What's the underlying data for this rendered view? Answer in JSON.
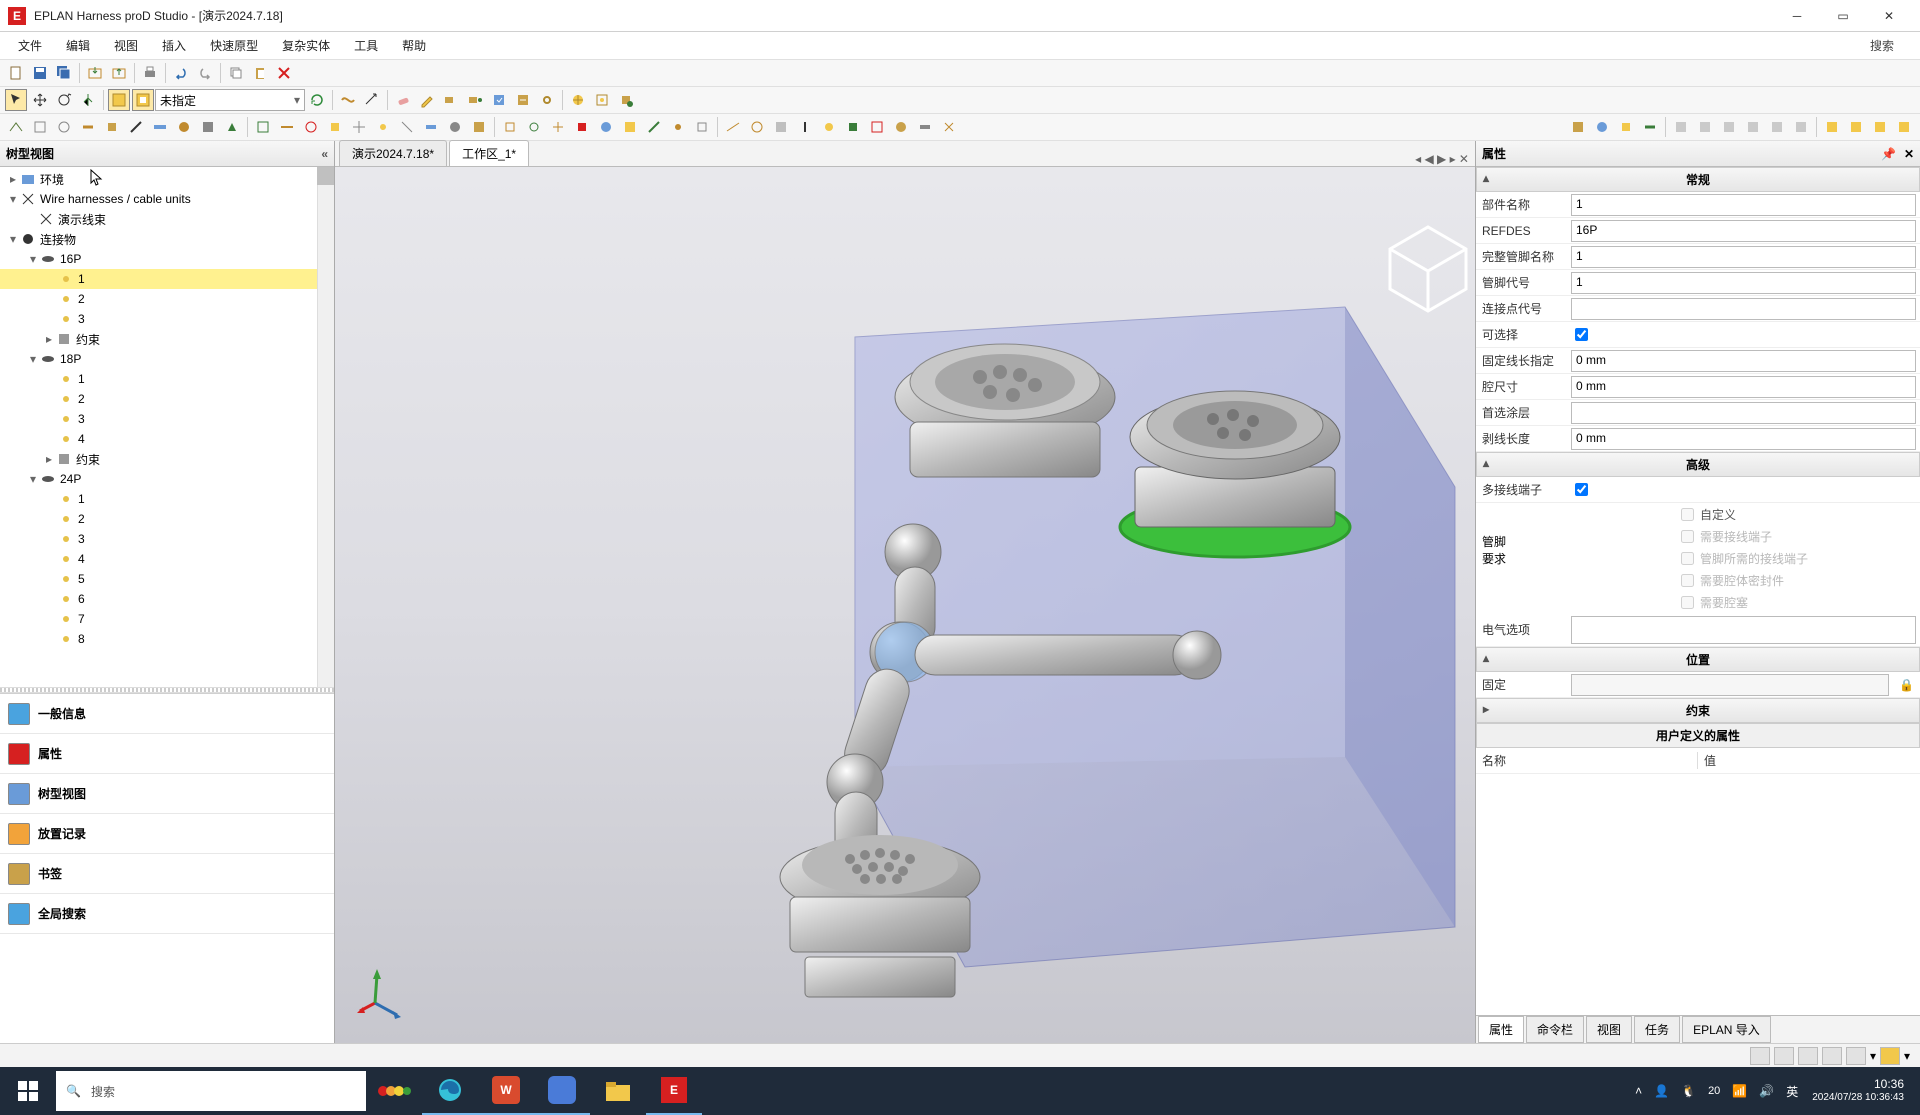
{
  "title": "EPLAN Harness proD Studio - [演示2024.7.18]",
  "menu": {
    "file": "文件",
    "edit": "编辑",
    "view": "视图",
    "insert": "插入",
    "rapid": "快速原型",
    "complex": "复杂实体",
    "tools": "工具",
    "help": "帮助",
    "search": "搜索"
  },
  "toolbar2_dropdown": "未指定",
  "left": {
    "header": "树型视图",
    "nodes": {
      "env": "环境",
      "wh": "Wire harnesses / cable units",
      "demo": "演示线束",
      "conn": "连接物",
      "p16": "16P",
      "p18": "18P",
      "p24": "24P",
      "n1": "1",
      "n2": "2",
      "n3": "3",
      "n4": "4",
      "n5": "5",
      "n6": "6",
      "n7": "7",
      "n8": "8",
      "cons": "约束"
    },
    "panels": {
      "info": "一般信息",
      "props": "属性",
      "tree": "树型视图",
      "place": "放置记录",
      "bm": "书签",
      "gs": "全局搜索"
    }
  },
  "tabs": {
    "doc1": "演示2024.7.18*",
    "doc2": "工作区_1*"
  },
  "right": {
    "header": "属性",
    "sec": {
      "gen": "常规",
      "adv": "高级",
      "pos": "位置",
      "cons": "约束",
      "user": "用户定义的属性"
    },
    "k": {
      "partname": "部件名称",
      "refdes": "REFDES",
      "fullpin": "完整管脚名称",
      "pincode": "管脚代号",
      "connpt": "连接点代号",
      "selectable": "可选择",
      "fixlen": "固定线长指定",
      "cavity": "腔尺寸",
      "coating": "首选涂层",
      "striplen": "剥线长度",
      "multiterm": "多接线端子",
      "pinreq": "管脚\n要求",
      "custom": "自定义",
      "needterm": "需要接线端子",
      "needpinterm": "管脚所需的接线端子",
      "needseal": "需要腔体密封件",
      "needplug": "需要腔塞",
      "elecopt": "电气选项",
      "fixed": "固定",
      "name": "名称",
      "value": "值"
    },
    "v": {
      "partname": "1",
      "refdes": "16P",
      "fullpin": "1",
      "pincode": "1",
      "fixlen": "0 mm",
      "cavity": "0 mm",
      "striplen": "0 mm"
    },
    "btabs": {
      "props": "属性",
      "cmd": "命令栏",
      "view": "视图",
      "task": "任务",
      "eplan": "EPLAN 导入"
    }
  },
  "taskbar": {
    "search_ph": "搜索",
    "ime": "英",
    "clock_t": "10:36",
    "clock_d": "2024/07/28 10:36:43",
    "temp": "20"
  }
}
